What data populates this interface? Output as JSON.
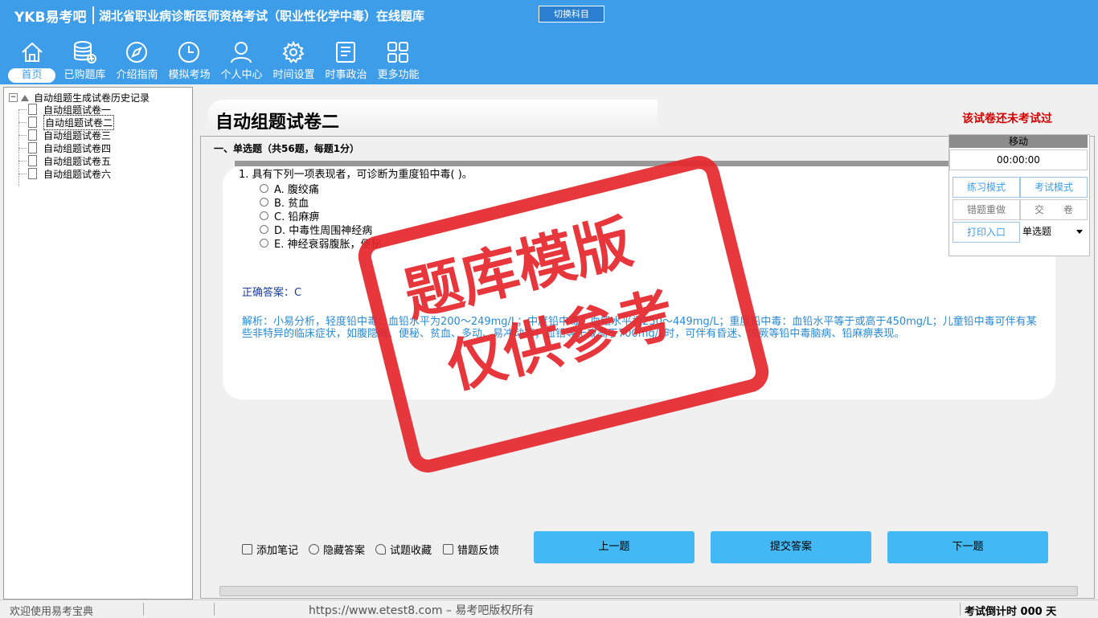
{
  "header": {
    "brand": "YKB易考吧",
    "title": "湖北省职业病诊断医师资格考试（职业性化学中毒）在线题库",
    "switch_label": "切换科目"
  },
  "nav": [
    {
      "label": "首页",
      "icon": "home-icon"
    },
    {
      "label": "已购题库",
      "icon": "database-icon"
    },
    {
      "label": "介绍指南",
      "icon": "compass-icon"
    },
    {
      "label": "模拟考场",
      "icon": "clock-icon"
    },
    {
      "label": "个人中心",
      "icon": "user-icon"
    },
    {
      "label": "时间设置",
      "icon": "gear-icon"
    },
    {
      "label": "时事政治",
      "icon": "news-icon"
    },
    {
      "label": "更多功能",
      "icon": "grid-icon"
    }
  ],
  "tree": {
    "root": "自动组题生成试卷历史记录",
    "items": [
      "自动组题试卷一",
      "自动组题试卷二",
      "自动组题试卷三",
      "自动组题试卷四",
      "自动组题试卷五",
      "自动组题试卷六"
    ],
    "selected": 1
  },
  "paper": {
    "title": "自动组题试卷二",
    "status": "该试卷还未考试过",
    "section": "一、单选题（共56题，每题1分）"
  },
  "question": {
    "text": "1. 具有下列一项表现者，可诊断为重度铅中毒( )。",
    "options": [
      "A. 腹绞痛",
      "B. 贫血",
      "C. 铅麻痹",
      "D. 中毒性周围神经病",
      "E. 神经衰弱腹胀，便秘"
    ],
    "answer": "正确答案：C",
    "analysis": "解析：小易分析，轻度铅中毒：血铅水平为200～249mg/L；中度铅中毒：血铅水平为250～449mg/L；重度铅中毒：血铅水平等于或高于450mg/L；儿童铅中毒可伴有某些非特异的临床症状，如腹隐痛、便秘、贫血、多动、易冲动等；血铅等于或高于700mg/L时，可伴有昏迷、惊厥等铅中毒脑病、铅麻痹表现。"
  },
  "watermark": {
    "line1": "题库模版",
    "line2": "仅供参考"
  },
  "panel": {
    "move": "移动",
    "timer": "00:00:00",
    "practice": "练习模式",
    "exam": "考试模式",
    "redo": "错题重做",
    "submit_paper": "交　　卷",
    "print": "打印入口",
    "type_select": "单选题"
  },
  "tools": [
    "添加笔记",
    "隐藏答案",
    "试题收藏",
    "错题反馈"
  ],
  "buttons": {
    "prev": "上一题",
    "submit": "提交答案",
    "next": "下一题"
  },
  "statusbar": {
    "welcome": "欢迎使用易考宝典",
    "url": "https://www.etest8.com – 易考吧版权所有",
    "countdown": "考试倒计时 000 天"
  },
  "colors": {
    "header": "#3d9de8",
    "button": "#42b8f5",
    "stamp": "#e5272c",
    "status": "#d40000"
  }
}
